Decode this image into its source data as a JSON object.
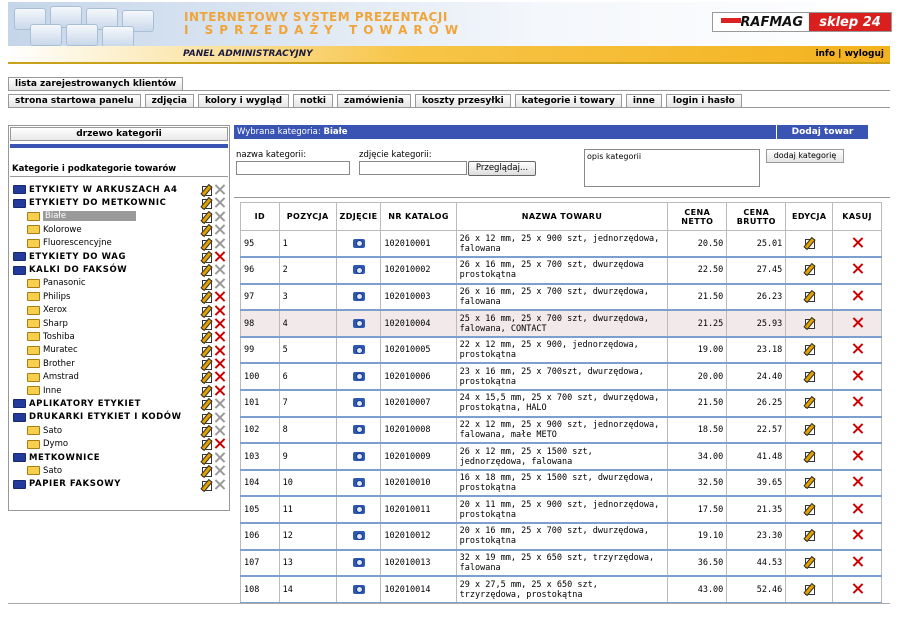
{
  "header": {
    "title_line1": "INTERNETOWY SYSTEM PREZENTACJI",
    "title_line2": "I SPRZEDAŻY TOWARÓW",
    "brand_name": "RAFMAG",
    "brand_shop": "sklep 24",
    "panel_label": "PANEL ADMINISTRACYJNY",
    "link_info": "info",
    "link_sep": "|",
    "link_logout": "wyloguj"
  },
  "nav": {
    "row1": [
      "lista zarejestrowanych klientów"
    ],
    "row2": [
      "strona startowa panelu",
      "zdjęcia",
      "kolory i wygląd",
      "notki",
      "zamówienia",
      "koszty przesyłki",
      "kategorie i towary",
      "inne",
      "login i hasło"
    ]
  },
  "sidebar": {
    "tree_button": "drzewo kategorii",
    "caption": "Kategorie i podkategorie towarów",
    "items": [
      {
        "label": "ETYKIETY W ARKUSZACH A4",
        "level": 0,
        "del": false
      },
      {
        "label": "ETYKIETY DO METKOWNIC",
        "level": 0,
        "del": false
      },
      {
        "label": "Białe",
        "level": 1,
        "del": false,
        "selected": true
      },
      {
        "label": "Kolorowe",
        "level": 1,
        "del": false
      },
      {
        "label": "Fluorescencyjne",
        "level": 1,
        "del": false
      },
      {
        "label": "ETYKIETY DO WAG",
        "level": 0,
        "del": true
      },
      {
        "label": "KALKI DO FAKSÓW",
        "level": 0,
        "del": false
      },
      {
        "label": "Panasonic",
        "level": 1,
        "del": false
      },
      {
        "label": "Philips",
        "level": 1,
        "del": true
      },
      {
        "label": "Xerox",
        "level": 1,
        "del": true
      },
      {
        "label": "Sharp",
        "level": 1,
        "del": true
      },
      {
        "label": "Toshiba",
        "level": 1,
        "del": true
      },
      {
        "label": "Muratec",
        "level": 1,
        "del": true
      },
      {
        "label": "Brother",
        "level": 1,
        "del": true
      },
      {
        "label": "Amstrad",
        "level": 1,
        "del": true
      },
      {
        "label": "Inne",
        "level": 1,
        "del": true
      },
      {
        "label": "APLIKATORY ETYKIET",
        "level": 0,
        "del": false
      },
      {
        "label": "DRUKARKI ETYKIET I KODÓW",
        "level": 0,
        "del": false
      },
      {
        "label": "Sato",
        "level": 1,
        "del": false
      },
      {
        "label": "Dymo",
        "level": 1,
        "del": true
      },
      {
        "label": "METKOWNICE",
        "level": 0,
        "del": false
      },
      {
        "label": "Sato",
        "level": 1,
        "del": false
      },
      {
        "label": "PAPIER FAKSOWY",
        "level": 0,
        "del": false
      }
    ]
  },
  "main": {
    "selected_prefix": "Wybrana kategoria:",
    "selected_name": "Białe",
    "add_product": "Dodaj towar",
    "form": {
      "name_label": "nazwa kategorii:",
      "photo_label": "zdjęcie kategorii:",
      "browse_label": "Przeglądaj...",
      "opis_placeholder": "opis kategorii",
      "add_button": "dodaj kategorię"
    },
    "table": {
      "headers": [
        "ID",
        "POZYCJA",
        "ZDJĘCIE",
        "NR KATALOG",
        "NAZWA TOWARU",
        "CENA NETTO",
        "CENA BRUTTO",
        "EDYCJA",
        "KASUJ"
      ],
      "rows": [
        {
          "id": "95",
          "pos": "1",
          "cat": "102010001",
          "name": "26 x 12 mm, 25 x 900 szt, jednorzędowa, falowana",
          "net": "20.50",
          "gross": "25.01"
        },
        {
          "id": "96",
          "pos": "2",
          "cat": "102010002",
          "name": "26 x 16 mm, 25 x 700 szt, dwurzędowa prostokątna",
          "net": "22.50",
          "gross": "27.45"
        },
        {
          "id": "97",
          "pos": "3",
          "cat": "102010003",
          "name": "26 x 16 mm, 25 x 700 szt, dwurzędowa, falowana",
          "net": "21.50",
          "gross": "26.23"
        },
        {
          "id": "98",
          "pos": "4",
          "cat": "102010004",
          "name": "25 x 16 mm, 25 x 700 szt, dwurzędowa, falowana, CONTACT",
          "net": "21.25",
          "gross": "25.93",
          "hl": true
        },
        {
          "id": "99",
          "pos": "5",
          "cat": "102010005",
          "name": "22 x 12 mm, 25 x 900, jednorzędowa, prostokątna",
          "net": "19.00",
          "gross": "23.18"
        },
        {
          "id": "100",
          "pos": "6",
          "cat": "102010006",
          "name": "23 x 16 mm, 25 x 700szt, dwurzędowa, prostokątna",
          "net": "20.00",
          "gross": "24.40"
        },
        {
          "id": "101",
          "pos": "7",
          "cat": "102010007",
          "name": "24 x 15,5 mm, 25 x 700 szt, dwurzędowa, prostokątna, HALO",
          "net": "21.50",
          "gross": "26.25"
        },
        {
          "id": "102",
          "pos": "8",
          "cat": "102010008",
          "name": "22 x 12 mm, 25 x 900 szt, jednorzędowa, falowana, małe METO",
          "net": "18.50",
          "gross": "22.57"
        },
        {
          "id": "103",
          "pos": "9",
          "cat": "102010009",
          "name": "26 x 12 mm, 25 x 1500 szt, jednorzędowa, falowana",
          "net": "34.00",
          "gross": "41.48"
        },
        {
          "id": "104",
          "pos": "10",
          "cat": "102010010",
          "name": "16 x 18 mm, 25 x 1500 szt, dwurzędowa, prostokątna",
          "net": "32.50",
          "gross": "39.65"
        },
        {
          "id": "105",
          "pos": "11",
          "cat": "102010011",
          "name": "20 x 11 mm, 25 x 900 szt, jednorzędowa, prostokątna",
          "net": "17.50",
          "gross": "21.35"
        },
        {
          "id": "106",
          "pos": "12",
          "cat": "102010012",
          "name": "20 x 16 mm, 25 x 700 szt, dwurzędowa, prostokątna",
          "net": "19.10",
          "gross": "23.30"
        },
        {
          "id": "107",
          "pos": "13",
          "cat": "102010013",
          "name": "32 x 19 mm, 25 x 650 szt, trzyrzędowa, falowana",
          "net": "36.50",
          "gross": "44.53"
        },
        {
          "id": "108",
          "pos": "14",
          "cat": "102010014",
          "name": "29 x 27,5 mm, 25 x 650 szt, trzyrzędowa, prostokątna",
          "net": "43.00",
          "gross": "52.46"
        }
      ]
    }
  },
  "icons": {
    "photo": "camera-icon",
    "edit": "edit-pencil-icon",
    "delete": "delete-x-icon",
    "folder": "folder-icon"
  },
  "colors": {
    "accent_blue": "#3a54b4",
    "header_orange": "#f0a53a",
    "brand_red": "#d9201f",
    "row_separator": "#7c9fd0"
  }
}
